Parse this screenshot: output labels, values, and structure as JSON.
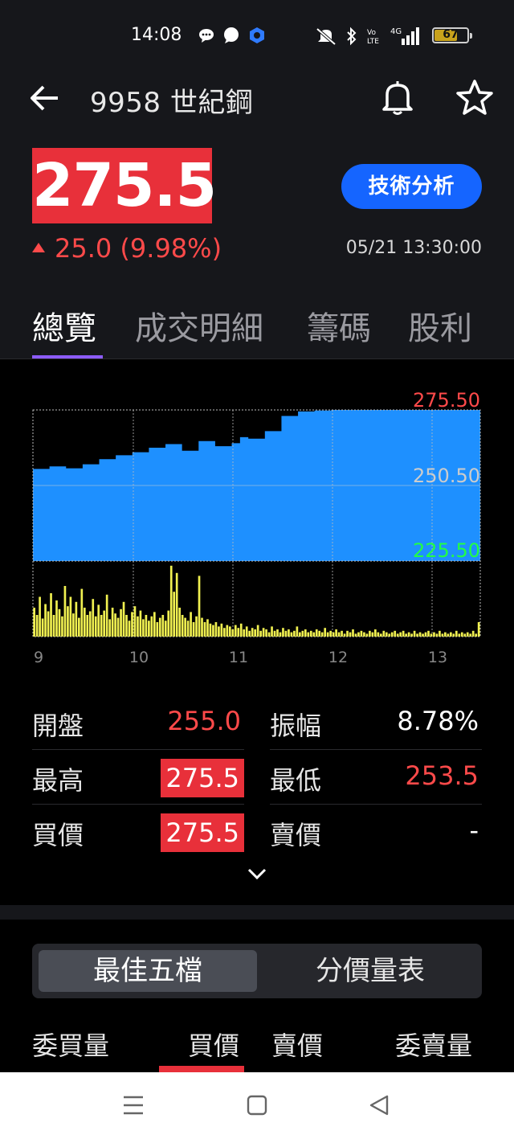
{
  "status_bar": {
    "time": "14:08",
    "battery": "67",
    "network": "4G"
  },
  "header": {
    "stock_title": "9958 世紀鋼"
  },
  "price": {
    "last": "275.5",
    "change": "25.0 (9.98%)",
    "datetime": "05/21 13:30:00",
    "tech_button": "技術分析"
  },
  "tabs": [
    {
      "label": "總覽"
    },
    {
      "label": "成交明細"
    },
    {
      "label": "籌碼"
    },
    {
      "label": "股利"
    }
  ],
  "chart_data": {
    "type": "area",
    "y_labels": [
      "275.50",
      "250.50",
      "225.50"
    ],
    "ylim": [
      225.5,
      275.5
    ],
    "reference": 250.5,
    "x_ticks": [
      "9",
      "10",
      "11",
      "12",
      "13"
    ],
    "price_series": [
      {
        "t": 0,
        "v": 256.0
      },
      {
        "t": 10,
        "v": 256.8
      },
      {
        "t": 20,
        "v": 256.2
      },
      {
        "t": 30,
        "v": 257.5
      },
      {
        "t": 40,
        "v": 259.2
      },
      {
        "t": 50,
        "v": 260.5
      },
      {
        "t": 60,
        "v": 261.5
      },
      {
        "t": 70,
        "v": 263.0
      },
      {
        "t": 80,
        "v": 264.2
      },
      {
        "t": 90,
        "v": 262.0
      },
      {
        "t": 100,
        "v": 265.2
      },
      {
        "t": 110,
        "v": 263.5
      },
      {
        "t": 120,
        "v": 264.5
      },
      {
        "t": 125,
        "v": 266.5
      },
      {
        "t": 130,
        "v": 266.0
      },
      {
        "t": 140,
        "v": 268.5
      },
      {
        "t": 150,
        "v": 273.5
      },
      {
        "t": 160,
        "v": 275.0
      },
      {
        "t": 170,
        "v": 275.3
      },
      {
        "t": 180,
        "v": 275.5
      },
      {
        "t": 270,
        "v": 275.5
      }
    ],
    "volume_series": [
      40,
      30,
      55,
      25,
      45,
      35,
      60,
      30,
      50,
      38,
      28,
      70,
      42,
      55,
      32,
      48,
      26,
      66,
      40,
      30,
      35,
      52,
      28,
      44,
      30,
      36,
      58,
      24,
      40,
      32,
      26,
      38,
      48,
      30,
      22,
      34,
      42,
      28,
      36,
      24,
      30,
      22,
      28,
      34,
      20,
      26,
      30,
      22,
      36,
      98,
      62,
      88,
      40,
      30,
      26,
      22,
      34,
      20,
      28,
      84,
      26,
      20,
      24,
      18,
      16,
      20,
      14,
      18,
      12,
      16,
      14,
      10,
      16,
      12,
      18,
      10,
      14,
      8,
      12,
      10,
      16,
      8,
      12,
      10,
      6,
      14,
      8,
      10,
      6,
      12,
      8,
      10,
      6,
      8,
      14,
      6,
      8,
      10,
      6,
      8,
      6,
      10,
      8,
      6,
      12,
      6,
      8,
      6,
      10,
      6,
      8,
      4,
      8,
      6,
      10,
      4,
      6,
      8,
      6,
      4,
      8,
      6,
      10,
      6,
      4,
      8,
      6,
      4,
      6,
      8,
      4,
      6,
      8,
      4,
      6,
      4,
      8,
      4,
      6,
      4,
      6,
      8,
      4,
      6,
      4,
      8,
      4,
      6,
      4,
      6,
      4,
      8,
      4,
      6,
      4,
      6,
      4,
      8,
      4,
      20
    ]
  },
  "stats": {
    "open_label": "開盤",
    "open": "255.0",
    "amp_label": "振幅",
    "amp": "8.78%",
    "high_label": "最高",
    "high": "275.5",
    "low_label": "最低",
    "low": "253.5",
    "bid_label": "買價",
    "bid": "275.5",
    "ask_label": "賣價",
    "ask": "-"
  },
  "order_book": {
    "seg_best": "最佳五檔",
    "seg_price": "分價量表",
    "col_bid_vol": "委買量",
    "col_bid": "買價",
    "col_ask": "賣價",
    "col_ask_vol": "委賣量"
  },
  "colors": {
    "up": "#ff4a4a",
    "accent": "#1565ff",
    "chart_fill": "#1e90ff",
    "volume": "#f0f050"
  }
}
